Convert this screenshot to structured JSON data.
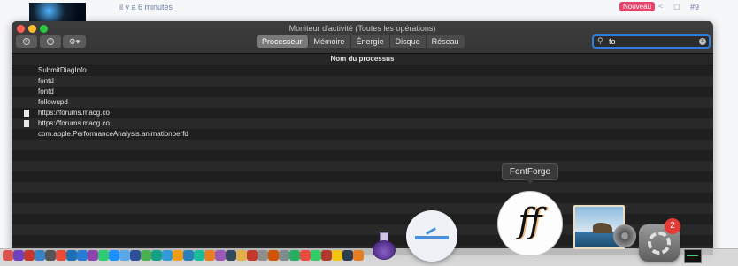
{
  "background_page": {
    "timestamp": "il y a 6 minutes",
    "badge": "Nouveau",
    "post_number": "#9"
  },
  "window": {
    "title": "Moniteur d'activité (Toutes les opérations)",
    "tabs": [
      {
        "label": "Processeur",
        "active": true
      },
      {
        "label": "Mémoire",
        "active": false
      },
      {
        "label": "Énergie",
        "active": false
      },
      {
        "label": "Disque",
        "active": false
      },
      {
        "label": "Réseau",
        "active": false
      }
    ],
    "search": {
      "value": "fo"
    },
    "column_header": "Nom du processus",
    "processes": [
      {
        "name": "SubmitDiagInfo",
        "has_icon": false
      },
      {
        "name": "fontd",
        "has_icon": false
      },
      {
        "name": "fontd",
        "has_icon": false
      },
      {
        "name": "followupd",
        "has_icon": false
      },
      {
        "name": "https://forums.macg.co",
        "has_icon": true
      },
      {
        "name": "https://forums.macg.co",
        "has_icon": true
      },
      {
        "name": "com.apple.PerformanceAnalysis.animationperfd",
        "has_icon": false
      },
      {
        "name": "",
        "has_icon": false
      },
      {
        "name": "",
        "has_icon": false
      },
      {
        "name": "",
        "has_icon": false
      },
      {
        "name": "",
        "has_icon": false
      },
      {
        "name": "",
        "has_icon": false
      },
      {
        "name": "",
        "has_icon": false
      },
      {
        "name": "",
        "has_icon": false
      },
      {
        "name": "",
        "has_icon": false
      },
      {
        "name": "",
        "has_icon": false
      },
      {
        "name": "",
        "has_icon": false
      },
      {
        "name": "",
        "has_icon": false
      }
    ]
  },
  "tooltip": "FontForge",
  "dock": {
    "system_prefs_badge": "2",
    "small_icon_colors": [
      "#d9534f",
      "#6f42c1",
      "#c0392b",
      "#3b82c4",
      "#555",
      "#e74c3c",
      "#1f6fb2",
      "#2b7bd6",
      "#8e44ad",
      "#2ecc71",
      "#1e90ff",
      "#5aa9e6",
      "#2f4f9e",
      "#4caf50",
      "#16a085",
      "#3498db",
      "#f39c12",
      "#2980b9",
      "#1abc9c",
      "#e67e22",
      "#9b59b6",
      "#34495e",
      "#e0b04a",
      "#c0392b",
      "#8e8e8e",
      "#d35400",
      "#7f8c8d",
      "#27ae60",
      "#e74c3c",
      "#3c6",
      "#b03a2e",
      "#f1c40f",
      "#2c3e50",
      "#e67e22"
    ]
  }
}
